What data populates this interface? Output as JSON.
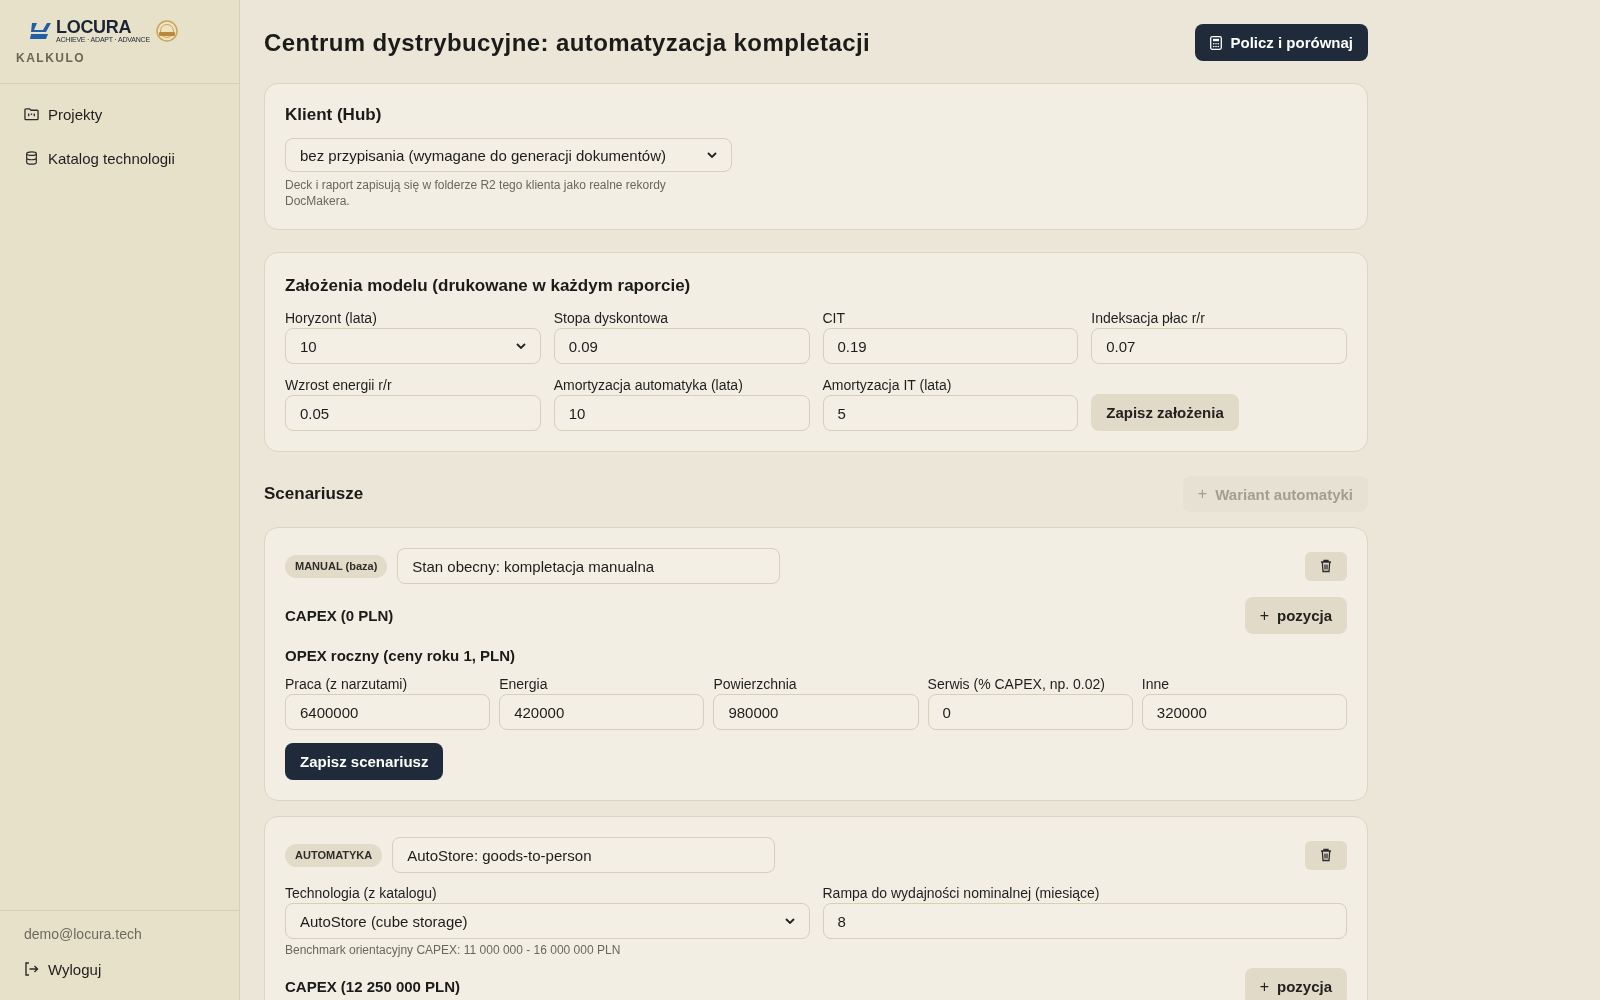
{
  "sidebar": {
    "logo": {
      "name": "LOCURA",
      "tagline": "ACHIEVE · ADAPT · ADVANCE"
    },
    "app_name": "KALKULO",
    "nav": [
      {
        "label": "Projekty",
        "selected": false
      },
      {
        "label": "Katalog technologii",
        "selected": false
      }
    ],
    "user_email": "demo@locura.tech",
    "logout": "Wyloguj"
  },
  "header": {
    "title": "Centrum dystrybucyjne: automatyzacja kompletacji",
    "calculate_button": "Policz i porównaj"
  },
  "client": {
    "title": "Klient (Hub)",
    "select_value": "bez przypisania (wymagane do generacji dokumentów)",
    "hint": "Deck i raport zapisują się w folderze R2 tego klienta jako realne rekordy DocMakera."
  },
  "assumptions": {
    "title": "Założenia modelu (drukowane w każdym raporcie)",
    "fields": [
      {
        "kind": "select",
        "label": "Horyzont (lata)",
        "value": "10"
      },
      {
        "kind": "input",
        "label": "Stopa dyskontowa",
        "value": "0.09"
      },
      {
        "kind": "input",
        "label": "CIT",
        "value": "0.19"
      },
      {
        "kind": "input",
        "label": "Indeksacja płac r/r",
        "value": "0.07"
      },
      {
        "kind": "input",
        "label": "Wzrost energii r/r",
        "value": "0.05"
      },
      {
        "kind": "input",
        "label": "Amortyzacja automatyka (lata)",
        "value": "10"
      },
      {
        "kind": "input",
        "label": "Amortyzacja IT (lata)",
        "value": "5"
      }
    ],
    "save_button": "Zapisz założenia"
  },
  "scenarios": {
    "title": "Scenariusze",
    "add_button": {
      "icon": "+",
      "label": "Wariant automatyki",
      "disabled": true
    },
    "items": [
      {
        "kind": "manual",
        "tag": "MANUAL (baza)",
        "name": "Stan obecny: kompletacja manualna",
        "capex_title": "CAPEX (0 PLN)",
        "add_position": {
          "icon": "+",
          "label": "pozycja"
        },
        "opex_title": "OPEX roczny (ceny roku 1, PLN)",
        "opex_fields": [
          {
            "label": "Praca (z narzutami)",
            "value": "6400000"
          },
          {
            "label": "Energia",
            "value": "420000"
          },
          {
            "label": "Powierzchnia",
            "value": "980000"
          },
          {
            "label": "Serwis (% CAPEX, np. 0.02)",
            "value": "0"
          },
          {
            "label": "Inne",
            "value": "320000"
          }
        ],
        "save_button": "Zapisz scenariusz"
      },
      {
        "kind": "automation",
        "tag": "AUTOMATYKA",
        "name": "AutoStore: goods-to-person",
        "details": [
          {
            "kind": "select",
            "label": "Technologia (z katalogu)",
            "value": "AutoStore (cube storage)",
            "hint": "Benchmark orientacyjny CAPEX: 11 000 000 - 16 000 000 PLN"
          },
          {
            "kind": "input",
            "label": "Rampa do wydajności nominalnej (miesiące)",
            "value": "8"
          }
        ],
        "capex_title": "CAPEX (12 250 000 PLN)",
        "add_position": {
          "icon": "+",
          "label": "pozycja"
        }
      }
    ]
  }
}
